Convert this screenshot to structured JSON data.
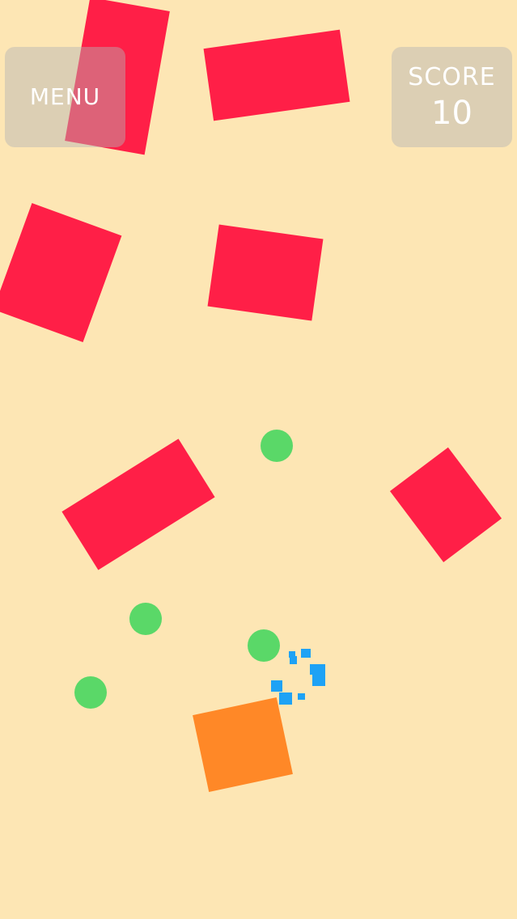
{
  "hud": {
    "menu_label": "MENU",
    "score_label": "SCORE",
    "score_value": "10"
  },
  "colors": {
    "background": "#fde6b4",
    "obstacle": "#ff1f47",
    "coin": "#5ad868",
    "player": "#ff8827",
    "particle": "#1ea2f5",
    "hud_panel": "rgba(180,180,180,0.45)",
    "hud_text": "#ffffff"
  }
}
